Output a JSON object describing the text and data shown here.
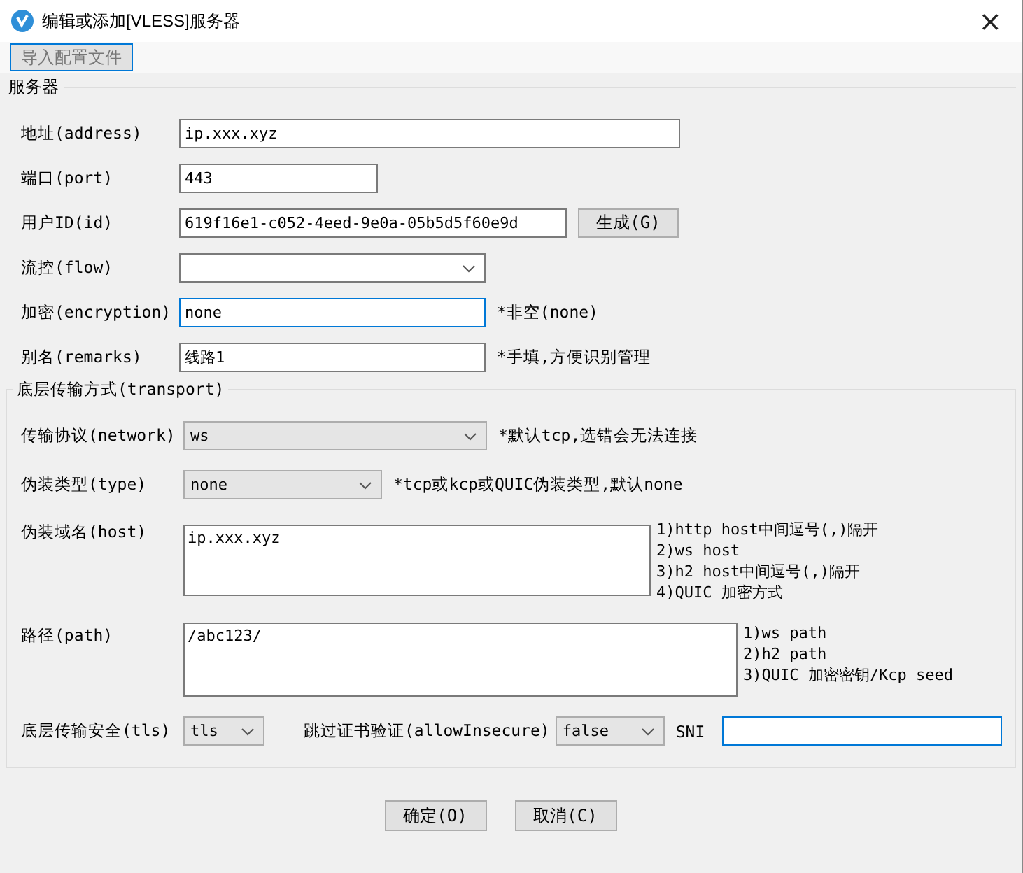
{
  "window": {
    "title": "编辑或添加[VLESS]服务器",
    "close": "×"
  },
  "toolbar": {
    "import_button": {
      "label": "导入配置文件",
      "focused": true
    }
  },
  "server": {
    "title": "服务器",
    "fields": [
      {
        "kind": "text",
        "label": "地址(address)",
        "value": "ip.xxx.xyz",
        "focused": false
      },
      {
        "kind": "text",
        "label": "端口(port)",
        "value": "443",
        "focused": false
      },
      {
        "kind": "text",
        "label": "用户ID(id)",
        "value": "619f16e1-c052-4eed-9e0a-05b5d5f60e9d",
        "focused": false,
        "button": "生成(G)"
      },
      {
        "kind": "select",
        "label": "流控(flow)"
      },
      {
        "kind": "text",
        "label": "加密(encryption)",
        "value": "none",
        "focused": true,
        "note": "*非空(none)"
      },
      {
        "kind": "text",
        "label": "别名(remarks)",
        "value": "线路1",
        "focused": false,
        "note": "*手填,方便识别管理"
      }
    ]
  },
  "transport": {
    "title": "底层传输方式(transport)",
    "fields": [
      {
        "kind": "select",
        "label": "传输协议(network)",
        "value": "ws",
        "note": "*默认tcp,选错会无法连接"
      },
      {
        "kind": "select",
        "label": "伪装类型(type)",
        "value": "none",
        "note": "*tcp或kcp或QUIC伪装类型,默认none"
      },
      {
        "kind": "textarea",
        "label": "伪装域名(host)",
        "value": "ip.xxx.xyz",
        "notes": [
          "1)http host中间逗号(,)隔开",
          "2)ws host",
          "3)h2 host中间逗号(,)隔开",
          "4)QUIC 加密方式"
        ]
      },
      {
        "kind": "textarea",
        "label": "路径(path)",
        "value": "/abc123/",
        "notes": [
          "1)ws path",
          "2)h2 path",
          "3)QUIC 加密密钥/Kcp seed"
        ]
      }
    ],
    "tls": {
      "label": "底层传输安全(tls)",
      "value": "tls",
      "insecure_label": "跳过证书验证(allowInsecure)",
      "insecure_value": "false",
      "sni_label": "SNI",
      "sni_focused": true
    }
  },
  "buttons": [
    "确定(O)",
    "取消(C)"
  ]
}
